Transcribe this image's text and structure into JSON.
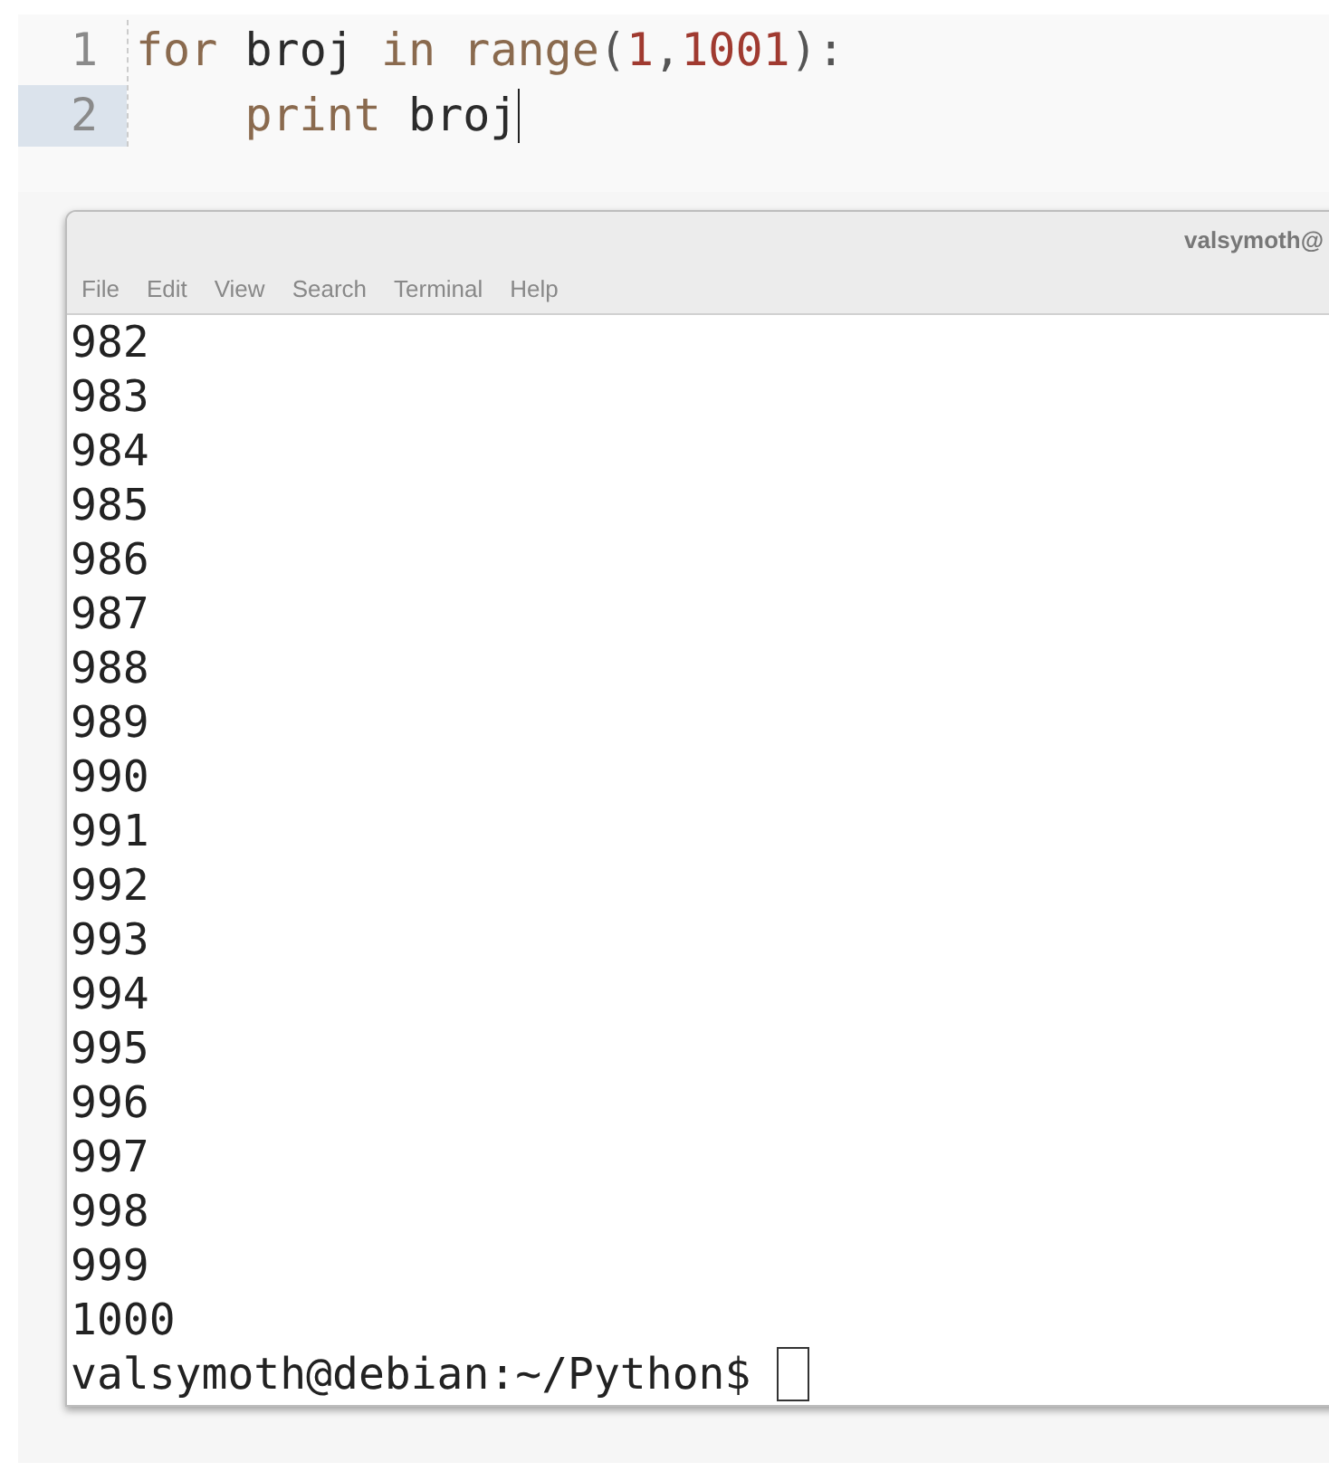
{
  "editor": {
    "lines": [
      {
        "number": "1",
        "selected": false,
        "tokens": [
          {
            "kind": "keyword",
            "text": "for "
          },
          {
            "kind": "name",
            "text": "broj "
          },
          {
            "kind": "keyword",
            "text": "in range"
          },
          {
            "kind": "punct",
            "text": "("
          },
          {
            "kind": "number",
            "text": "1"
          },
          {
            "kind": "punct",
            "text": ","
          },
          {
            "kind": "number",
            "text": "1001"
          },
          {
            "kind": "punct",
            "text": "):"
          }
        ]
      },
      {
        "number": "2",
        "selected": true,
        "tokens": [
          {
            "kind": "keyword",
            "text": "    print "
          },
          {
            "kind": "name",
            "text": "broj"
          }
        ]
      }
    ]
  },
  "terminal": {
    "title": "valsymoth@",
    "menu": [
      "File",
      "Edit",
      "View",
      "Search",
      "Terminal",
      "Help"
    ],
    "output": [
      "982",
      "983",
      "984",
      "985",
      "986",
      "987",
      "988",
      "989",
      "990",
      "991",
      "992",
      "993",
      "994",
      "995",
      "996",
      "997",
      "998",
      "999",
      "1000"
    ],
    "prompt": "valsymoth@debian:~/Python$"
  }
}
